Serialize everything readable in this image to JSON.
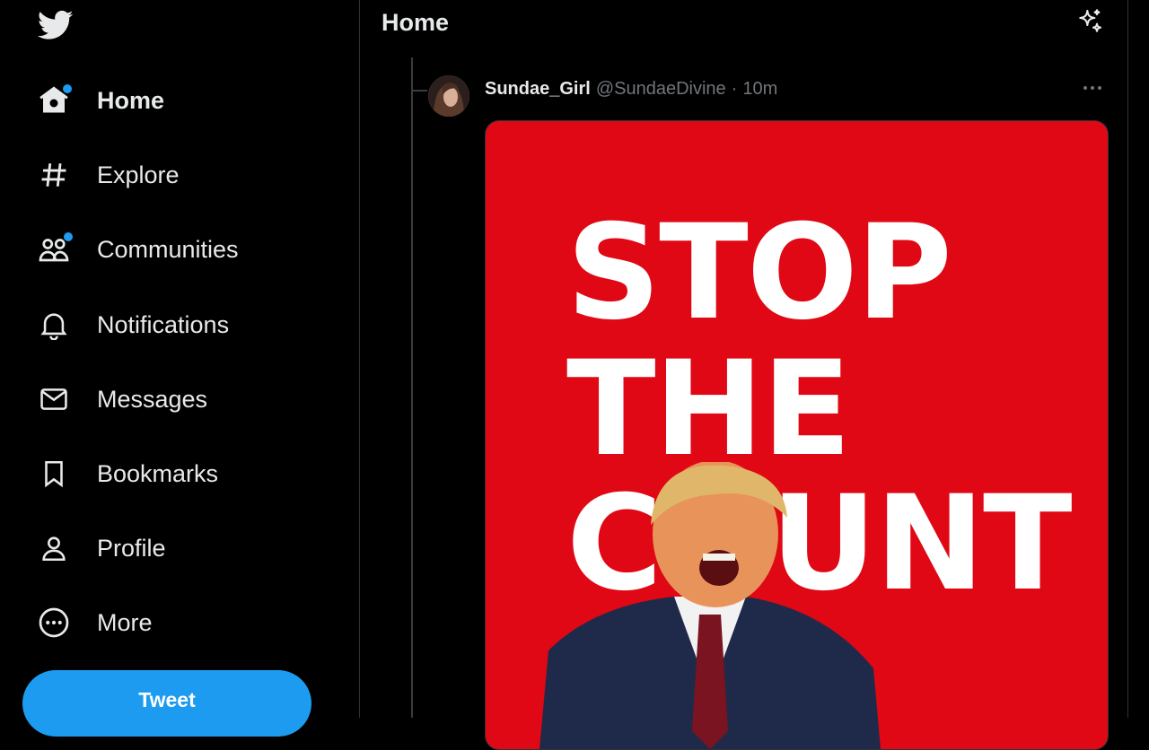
{
  "sidebar": {
    "nav": [
      {
        "label": "Home",
        "icon": "home-icon",
        "active": true,
        "badge": true
      },
      {
        "label": "Explore",
        "icon": "hashtag-icon"
      },
      {
        "label": "Communities",
        "icon": "communities-icon",
        "badge": true
      },
      {
        "label": "Notifications",
        "icon": "bell-icon"
      },
      {
        "label": "Messages",
        "icon": "envelope-icon"
      },
      {
        "label": "Bookmarks",
        "icon": "bookmark-icon"
      },
      {
        "label": "Profile",
        "icon": "person-icon"
      },
      {
        "label": "More",
        "icon": "more-circle-icon"
      }
    ],
    "tweet_button": "Tweet"
  },
  "header": {
    "title": "Home"
  },
  "tweet": {
    "name": "Sundae_Girl",
    "handle": "@SundaeDivine",
    "separator": "·",
    "time": "10m",
    "media_text": [
      "STOP",
      "THE",
      "COUNT"
    ]
  },
  "colors": {
    "accent": "#1d9bf0",
    "background": "#000000",
    "media_red": "#e00814",
    "text": "#e7e9ea",
    "muted": "#71767b"
  }
}
